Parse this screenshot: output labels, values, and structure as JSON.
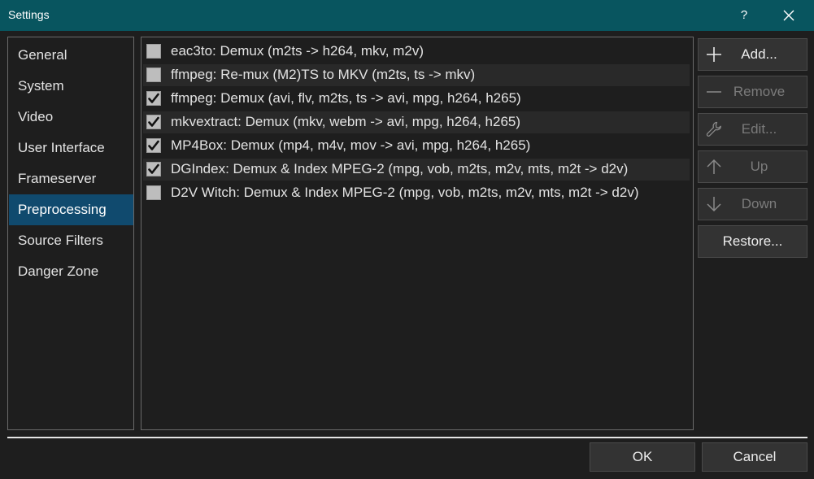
{
  "window": {
    "title": "Settings",
    "help_label": "?"
  },
  "nav": {
    "items": [
      {
        "label": "General",
        "selected": false
      },
      {
        "label": "System",
        "selected": false
      },
      {
        "label": "Video",
        "selected": false
      },
      {
        "label": "User Interface",
        "selected": false
      },
      {
        "label": "Frameserver",
        "selected": false
      },
      {
        "label": "Preprocessing",
        "selected": true
      },
      {
        "label": "Source Filters",
        "selected": false
      },
      {
        "label": "Danger Zone",
        "selected": false
      }
    ]
  },
  "list": {
    "rows": [
      {
        "label": "eac3to: Demux (m2ts -> h264, mkv, m2v)",
        "checked": false
      },
      {
        "label": "ffmpeg: Re-mux (M2)TS to MKV (m2ts, ts -> mkv)",
        "checked": false
      },
      {
        "label": "ffmpeg: Demux (avi, flv, m2ts, ts -> avi, mpg, h264, h265)",
        "checked": true
      },
      {
        "label": "mkvextract: Demux (mkv, webm -> avi, mpg, h264, h265)",
        "checked": true
      },
      {
        "label": "MP4Box: Demux (mp4, m4v, mov -> avi, mpg, h264, h265)",
        "checked": true
      },
      {
        "label": "DGIndex: Demux & Index MPEG-2 (mpg, vob, m2ts, m2v, mts, m2t -> d2v)",
        "checked": true
      },
      {
        "label": "D2V Witch: Demux & Index MPEG-2 (mpg, vob, m2ts, m2v, mts, m2t -> d2v)",
        "checked": false
      }
    ]
  },
  "side_buttons": {
    "add": {
      "label": "Add...",
      "enabled": true,
      "icon": "plus-icon"
    },
    "remove": {
      "label": "Remove",
      "enabled": false,
      "icon": "minus-icon"
    },
    "edit": {
      "label": "Edit...",
      "enabled": false,
      "icon": "wrench-icon"
    },
    "up": {
      "label": "Up",
      "enabled": false,
      "icon": "arrow-up-icon"
    },
    "down": {
      "label": "Down",
      "enabled": false,
      "icon": "arrow-down-icon"
    },
    "restore": {
      "label": "Restore...",
      "enabled": true
    }
  },
  "dialog_buttons": {
    "ok": "OK",
    "cancel": "Cancel"
  },
  "colors": {
    "titlebar": "#08555f",
    "background": "#1e1e1e",
    "selected_nav": "#104a6e",
    "button": "#333333"
  }
}
